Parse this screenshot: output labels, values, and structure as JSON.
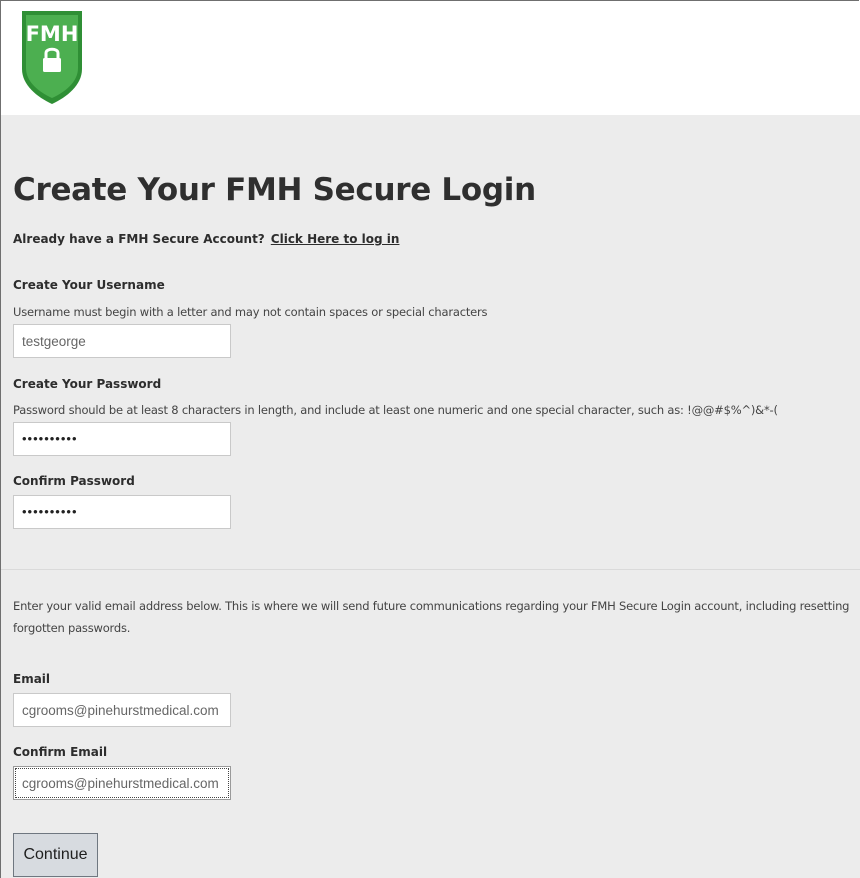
{
  "header": {
    "logo_text": "FMH",
    "logo_icon": "lock-shield-icon",
    "logo_color": "#3a9a3e"
  },
  "main": {
    "title": "Create Your FMH Secure Login",
    "already_text": "Already have a FMH Secure Account?",
    "login_link": "Click Here to log in",
    "username": {
      "label": "Create Your Username",
      "hint": "Username must begin with a letter and may not contain spaces or special characters",
      "value": "testgeorge"
    },
    "password": {
      "label": "Create Your Password",
      "hint": "Password should be at least 8 characters in length, and include at least one numeric and one special character, such as: !@@#$%^)&*-(",
      "value": "••••••••••"
    },
    "confirm_password": {
      "label": "Confirm Password",
      "value": "••••••••••"
    },
    "email_note": "Enter your valid email address below. This is where we will send future communications regarding your FMH Secure Login account, including resetting forgotten passwords.",
    "email": {
      "label": "Email",
      "value": "cgrooms@pinehurstmedical.com"
    },
    "confirm_email": {
      "label": "Confirm Email",
      "value": "cgrooms@pinehurstmedical.com"
    },
    "continue_label": "Continue"
  }
}
